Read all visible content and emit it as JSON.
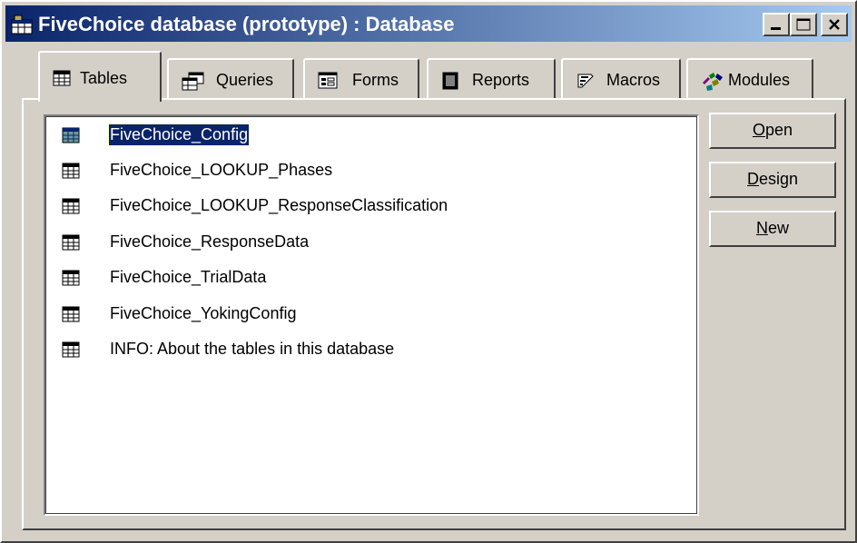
{
  "window": {
    "title": "FiveChoice database (prototype) : Database",
    "controls": {
      "minimize": "minimize-icon",
      "maximize": "maximize-icon",
      "close": "close-icon"
    }
  },
  "tabs": [
    {
      "label": "Tables",
      "icon": "table-icon",
      "active": true
    },
    {
      "label": "Queries",
      "icon": "query-icon"
    },
    {
      "label": "Forms",
      "icon": "form-icon"
    },
    {
      "label": "Reports",
      "icon": "report-icon"
    },
    {
      "label": "Macros",
      "icon": "macro-icon"
    },
    {
      "label": "Modules",
      "icon": "module-icon"
    }
  ],
  "objects": [
    {
      "name": "FiveChoice_Config",
      "selected": true
    },
    {
      "name": "FiveChoice_LOOKUP_Phases"
    },
    {
      "name": "FiveChoice_LOOKUP_ResponseClassification"
    },
    {
      "name": "FiveChoice_ResponseData"
    },
    {
      "name": "FiveChoice_TrialData"
    },
    {
      "name": "FiveChoice_YokingConfig"
    },
    {
      "name": "INFO: About the tables in this database"
    }
  ],
  "buttons": {
    "open": {
      "mnemonic": "O",
      "rest": "pen"
    },
    "design": {
      "mnemonic": "D",
      "rest": "esign"
    },
    "new": {
      "mnemonic": "N",
      "rest": "ew"
    }
  },
  "colors": {
    "titlebar_start": "#0a246a",
    "titlebar_end": "#a6caf0",
    "selection": "#0a246a",
    "face": "#d4d0c8"
  }
}
